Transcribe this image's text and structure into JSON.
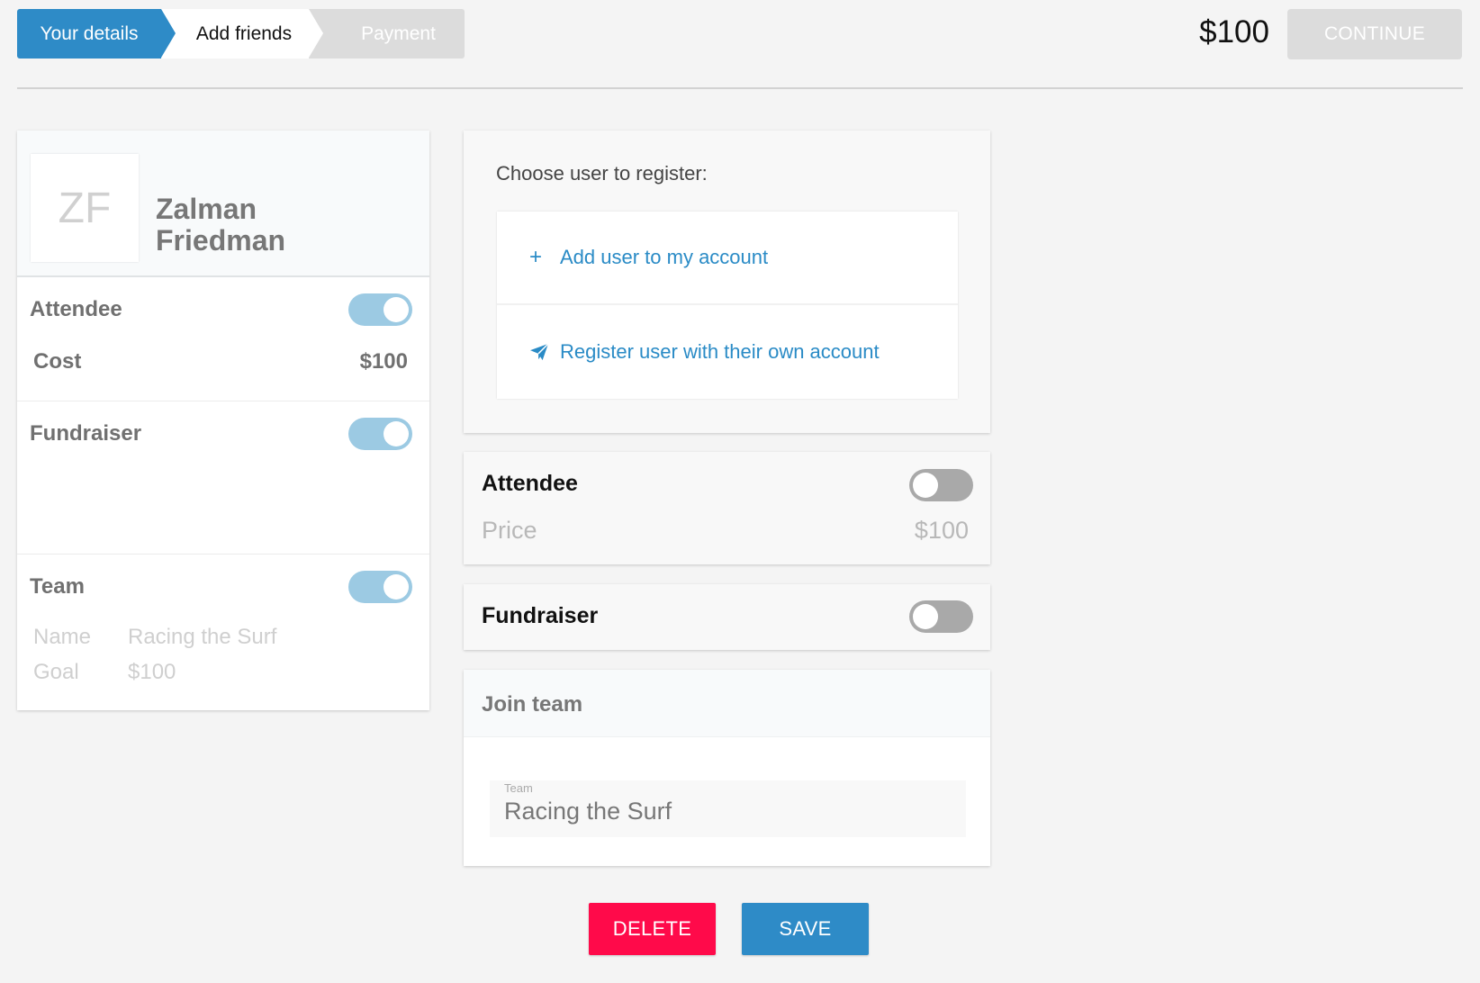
{
  "stepper": {
    "steps": [
      {
        "label": "Your details",
        "state": "done"
      },
      {
        "label": "Add friends",
        "state": "active"
      },
      {
        "label": "Payment",
        "state": "disabled"
      }
    ]
  },
  "header": {
    "total": "$100",
    "continue_label": "CONTINUE"
  },
  "profile": {
    "initials": "ZF",
    "name": "Zalman Friedman",
    "attendee": {
      "label": "Attendee",
      "enabled": true,
      "cost_label": "Cost",
      "cost_value": "$100"
    },
    "fundraiser": {
      "label": "Fundraiser",
      "enabled": true
    },
    "team": {
      "label": "Team",
      "enabled": true,
      "name_key": "Name",
      "name_value": "Racing the Surf",
      "goal_key": "Goal",
      "goal_value": "$100"
    }
  },
  "register": {
    "title": "Choose user to register:",
    "options": [
      {
        "label": "Add user to my account",
        "icon": "plus-icon"
      },
      {
        "label": "Register user with their own account",
        "icon": "paper-plane-icon"
      }
    ]
  },
  "attendee_card": {
    "title": "Attendee",
    "enabled": false,
    "price_label": "Price",
    "price_value": "$100"
  },
  "fundraiser_card": {
    "title": "Fundraiser",
    "enabled": false
  },
  "join_team": {
    "title": "Join team",
    "field_label": "Team",
    "field_value": "Racing the Surf"
  },
  "actions": {
    "delete_label": "DELETE",
    "save_label": "SAVE"
  },
  "colors": {
    "primary": "#2e8bc7",
    "danger": "#ff0a4a",
    "toggle_on": "#9ccae3",
    "toggle_off": "#a9a9a9",
    "disabled": "#dcdcdc"
  }
}
